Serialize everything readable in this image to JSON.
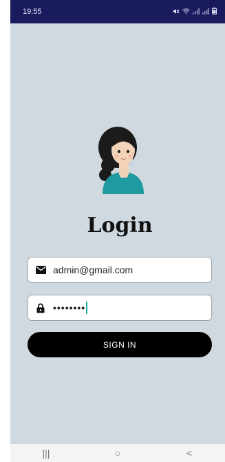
{
  "status_bar": {
    "time": "19:55",
    "icons": [
      "mute-icon",
      "wifi-icon",
      "signal-icon",
      "signal-icon",
      "battery-icon"
    ]
  },
  "login": {
    "title": "Login",
    "email": {
      "value": "admin@gmail.com",
      "icon": "envelope-icon"
    },
    "password": {
      "value": "••••••••",
      "icon": "lock-icon"
    },
    "signin_label": "SIGN IN"
  },
  "nav_bar": {
    "recents": "|||",
    "home": "○",
    "back": "<"
  },
  "colors": {
    "status_bar_bg": "#1a1a5e",
    "page_bg": "#d0d9e0",
    "button_bg": "#000000",
    "caret": "#1fa8a0"
  }
}
